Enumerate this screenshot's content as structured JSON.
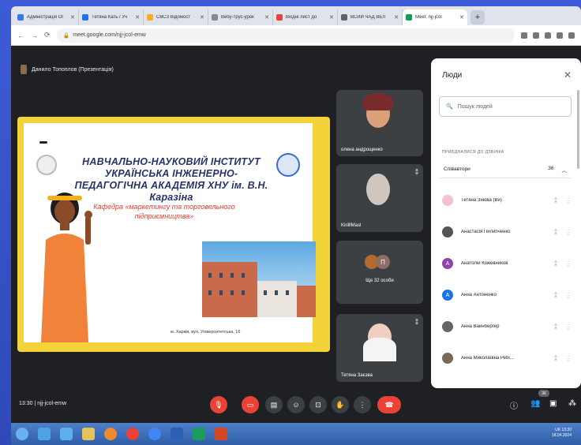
{
  "browser": {
    "tabs": [
      {
        "label": "Адміністрація Ог",
        "color": "#3b78e7"
      },
      {
        "label": "Тетяна Кать / Уч",
        "color": "#1a73e8"
      },
      {
        "label": "СВСЗ Відомост",
        "color": "#f2b01e"
      },
      {
        "label": "Вебу-трус-урок",
        "color": "#888888"
      },
      {
        "label": "Вхідні лист до",
        "color": "#ea4335"
      },
      {
        "label": "ВСИИ ЧАД ВЕЛ",
        "color": "#5f6368"
      },
      {
        "label": "Meet: njj-jcol",
        "color": "#0f9d58"
      }
    ],
    "url": "meet.google.com/njj-jcol-emw"
  },
  "meet": {
    "presenter": "Данило Топоплов (Презентація)",
    "slide": {
      "title": "НАВЧАЛЬНО-НАУКОВИЙ ІНСТИТУТ УКРАЇНСЬКА ІНЖЕНЕРНО-ПЕДАГОГІЧНА АКАДЕМІЯ ХНУ ім. В.Н. Каразіна",
      "subtitle": "Кафедра «маркетингу та торговельного підприємництва»",
      "address": "м. Харків, вул. Університетська, 16"
    },
    "tiles": [
      {
        "name": "олена андрощенко"
      },
      {
        "name": "KirilllMasl"
      },
      {
        "name": "Тетяна Заєзва"
      }
    ],
    "more_label": "Ще 32 особи",
    "more_initials": "П",
    "meeting_time": "13:30",
    "meeting_code": "njj-jcol-emw",
    "people_badge": "36"
  },
  "people": {
    "title": "Люди",
    "search_placeholder": "Пошук людей",
    "section": "ПРИЄДНАЛИСЯ ДО ДЗВІНКА",
    "group": {
      "label": "Співавтори",
      "count": "36"
    },
    "list": [
      {
        "name": "Тетяна Зінова (Ви)",
        "avatar": "#f6c0d0",
        "initial": ""
      },
      {
        "name": "Анастасія Пилипченко",
        "avatar": "#555555",
        "initial": ""
      },
      {
        "name": "Анатолій Кожевников",
        "avatar": "#8e44ad",
        "initial": "A"
      },
      {
        "name": "Анна Антоненко",
        "avatar": "#1a73e8",
        "initial": "A"
      },
      {
        "name": "Анна Вайнбергер",
        "avatar": "#666666",
        "initial": ""
      },
      {
        "name": "Анна Миколаївна Ребі...",
        "avatar": "#7a6a55",
        "initial": ""
      }
    ]
  },
  "taskbar": {
    "clock": "13:30",
    "date": "18.04.2024",
    "lang": "UK"
  }
}
